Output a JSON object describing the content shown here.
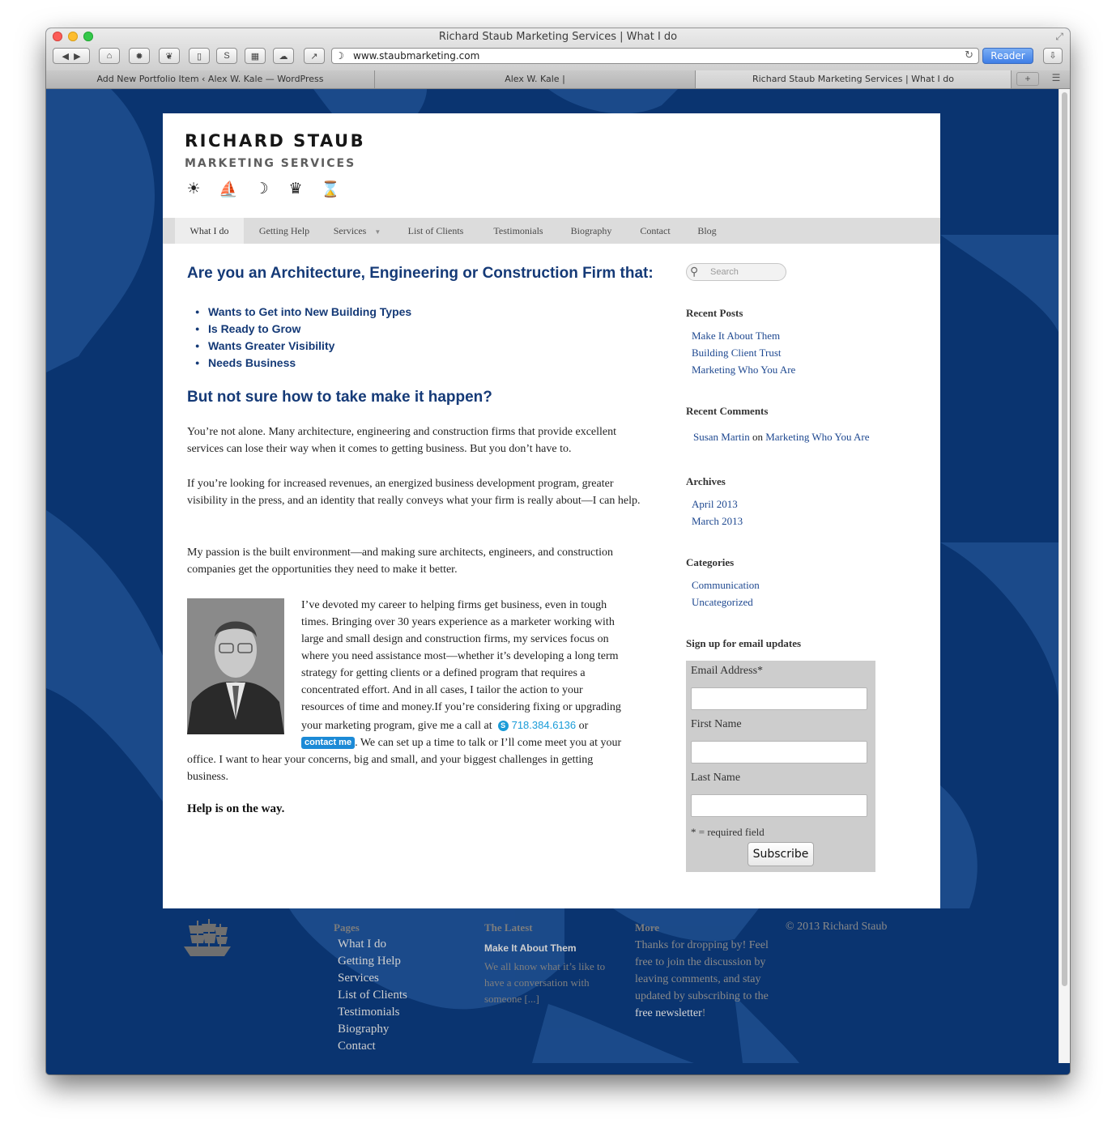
{
  "window": {
    "title": "Richard Staub Marketing Services | What I do",
    "url": "www.staubmarketing.com",
    "reader_label": "Reader",
    "tabs": [
      {
        "label": "Add New Portfolio Item ‹ Alex W. Kale — WordPress"
      },
      {
        "label": "Alex W. Kale |"
      },
      {
        "label": "Richard Staub Marketing Services | What I do"
      }
    ]
  },
  "site": {
    "brand_name": "RICHARD STAUB",
    "brand_sub": "MARKETING SERVICES"
  },
  "nav": {
    "items": [
      {
        "label": "What I do"
      },
      {
        "label": "Getting Help"
      },
      {
        "label": "Services"
      },
      {
        "label": "List of Clients"
      },
      {
        "label": "Testimonials"
      },
      {
        "label": "Biography"
      },
      {
        "label": "Contact"
      },
      {
        "label": "Blog"
      }
    ]
  },
  "main": {
    "question": "Are you an Architecture, Engineering or Construction Firm that:",
    "bullets": [
      "Wants to Get into New Building Types",
      "Is Ready to Grow",
      "Wants Greater Visibility",
      "Needs Business"
    ],
    "subheading": "But not sure how to take make it happen?",
    "para1": "You’re not alone. Many architecture, engineering and construction firms that provide excellent services can lose their way when it comes to getting business. But you don’t have to.",
    "para2": "If you’re looking for increased revenues, an energized business development program, greater visibility in the press, and an identity that really conveys what your firm is really about—I can help.",
    "para3": "My passion is the built environment—and making sure architects, engineers, and construction companies get the opportunities they need to make it better.",
    "bio_lines": [
      "I’ve devoted my career to helping firms get business, even in tough",
      "times. Bringing over 30 years experience as a marketer working with",
      "large and small design and construction firms, my services focus on",
      "where you need assistance most—whether it’s developing a long term",
      "strategy for getting clients or a defined program that requires a",
      "concentrated effort. And in all cases, I tailor the action to your",
      "resources of time and money.If you’re considering fixing or upgrading"
    ],
    "bio_call_prefix": "your marketing program, give me a call at",
    "phone": "718.384.6136",
    "bio_or": "or",
    "contact_badge": "contact me",
    "bio_after_badge": ". We can set up a time to talk or I’ll come meet you at your",
    "bio_tail_1": "office. I want to hear your concerns, big and small, and your biggest challenges in getting",
    "bio_tail_2": "business.",
    "help_line": "Help is on the way."
  },
  "sidebar": {
    "search_placeholder": "Search",
    "recent_posts_heading": "Recent Posts",
    "recent_posts": [
      "Make It About Them",
      "Building Client Trust",
      "Marketing Who You Are"
    ],
    "recent_comments_heading": "Recent Comments",
    "comment_author": "Susan Martin",
    "comment_on": "on",
    "comment_post": "Marketing Who You Are",
    "archives_heading": "Archives",
    "archives": [
      "April 2013",
      "March 2013"
    ],
    "categories_heading": "Categories",
    "categories": [
      "Communication",
      "Uncategorized"
    ],
    "signup_heading": "Sign up for email updates",
    "email_label": "Email Address*",
    "first_name_label": "First Name",
    "last_name_label": "Last Name",
    "required_note": "* = required field",
    "subscribe_label": "Subscribe"
  },
  "footer": {
    "pages_heading": "Pages",
    "pages": [
      "What I do",
      "Getting Help",
      "Services",
      "List of Clients",
      "Testimonials",
      "Biography",
      "Contact"
    ],
    "latest_heading": "The Latest",
    "latest_title": "Make It About Them",
    "latest_excerpt_lines": [
      "We all know what it’s like to",
      "have a conversation with",
      "someone [...]"
    ],
    "more_heading": "More",
    "more_text": "Thanks for dropping by! Feel free to join the discussion by leaving comments, and stay updated by subscribing to the",
    "more_link": "free newsletter",
    "more_end": "!",
    "copyright": "© 2013 Richard Staub"
  },
  "colors": {
    "page_background": "#0a3470",
    "heading_blue": "#153a77",
    "link_blue": "#1e4890",
    "skype_blue": "#1a9cd8"
  }
}
